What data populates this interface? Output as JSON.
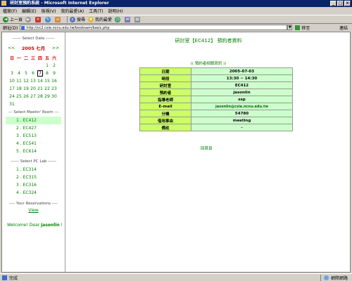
{
  "window": {
    "title": "研討室預約系統 - Microsoft Internet Explorer"
  },
  "menu": [
    "檔案(F)",
    "編輯(E)",
    "檢視(V)",
    "我的最愛(A)",
    "工具(T)",
    "說明(H)"
  ],
  "toolbar": {
    "back": "上一頁",
    "search": "搜尋",
    "favorites": "我的最愛"
  },
  "address": {
    "label": "網址(D)",
    "url": "http://vc2.csie.ncnu.edu.tw/booksam/basic.php",
    "go": "移至",
    "links": "連結"
  },
  "sidebar": {
    "date_title": "------ Select Date ------",
    "prev": "<<",
    "month": "2005 七月",
    "next": ">>",
    "weekdays": [
      "日",
      "一",
      "二",
      "三",
      "四",
      "五",
      "六"
    ],
    "weeks": [
      [
        "",
        "",
        "",
        "",
        "",
        "1",
        "2"
      ],
      [
        "3",
        "4",
        "5",
        "6",
        "7",
        "8",
        "9"
      ],
      [
        "10",
        "11",
        "12",
        "13",
        "14",
        "15",
        "16"
      ],
      [
        "17",
        "18",
        "19",
        "20",
        "21",
        "22",
        "23"
      ],
      [
        "24",
        "25",
        "26",
        "27",
        "28",
        "29",
        "30"
      ],
      [
        "31",
        "",
        "",
        "",
        "",
        "",
        ""
      ]
    ],
    "today": "7",
    "room_title": "--- Select Meetin' Room ---",
    "rooms": [
      "1 . EC412",
      "2 . EC427",
      "3 . EC513",
      "4 . EC541",
      "5 . EC614"
    ],
    "selected_room": 0,
    "lab_title": "------ Select PC Lab ------",
    "labs": [
      "1 . EC314",
      "2 . EC315",
      "3 . EC316",
      "4 . EC324"
    ],
    "resv_title": "---- Your Reservations ----",
    "view": "View",
    "welcome_prefix": "Welcome! Dear ",
    "username": "jasonlin",
    "welcome_suffix": " !"
  },
  "main": {
    "title": "研討室【EC412】 預約者資料",
    "back": "(( 預約者相關資訊 ))",
    "rows": [
      {
        "k": "日期",
        "v": "2005-07-03"
      },
      {
        "k": "時段",
        "v": "13:30 ~ 14:30"
      },
      {
        "k": "研討室",
        "v": "EC412"
      },
      {
        "k": "預約者",
        "v": "jasonlin"
      },
      {
        "k": "指導老師",
        "v": "ssp"
      },
      {
        "k": "E-mail",
        "v": "jasonlin@csie.ncnu.edu.tw"
      },
      {
        "k": "分機",
        "v": "54780"
      },
      {
        "k": "借用事由",
        "v": "meeting"
      },
      {
        "k": "備註",
        "v": "-"
      }
    ],
    "home": "回首頁"
  },
  "status": {
    "text": "完成",
    "zone": "網際網路"
  },
  "colors": {
    "accent": "#008000",
    "key_bg": "#ccff66",
    "value_bg": "#ccffcc",
    "title_bar": "#0a246a"
  }
}
